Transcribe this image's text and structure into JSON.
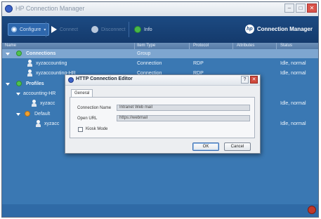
{
  "window": {
    "title": "HP Connection Manager"
  },
  "toolbar": {
    "configure": "Configure",
    "connect": "Connect",
    "disconnect": "Disconnect",
    "info": "Info",
    "brand": "Connection Manager",
    "brand_logo": "hp"
  },
  "columns": [
    "Name",
    "Item Type",
    "Protocol",
    "Attributes",
    "Status"
  ],
  "tree": {
    "connections": {
      "label": "Connections",
      "type": "Group",
      "items": [
        {
          "name": "xyzaccounting",
          "type": "Connection",
          "protocol": "RDP",
          "status": "Idle, normal"
        },
        {
          "name": "xyzaccounting-HR",
          "type": "Connection",
          "protocol": "RDP",
          "status": "Idle, normal"
        }
      ]
    },
    "profiles": {
      "label": "Profiles",
      "accounting": {
        "label": "accounting-HR",
        "item": {
          "name": "xyzacc",
          "status": "Idle, normal"
        }
      },
      "default": {
        "label": "Default",
        "item": {
          "name": "xyzacc",
          "status": "Idle, normal"
        }
      }
    }
  },
  "dialog": {
    "title": "HTTP Connection Editor",
    "tab": "General",
    "connection_name_label": "Connection Name",
    "connection_name_value": "Intranet Web mail",
    "open_url_label": "Open URL",
    "open_url_value": "https://webmail",
    "kiosk_label": "Kiosk Mode",
    "kiosk_checked": false,
    "ok": "OK",
    "cancel": "Cancel"
  },
  "colors": {
    "toolbar": "#143a6c",
    "body": "#3a78b3",
    "selected_row": "#7ea6d0",
    "status_icon": "#c0392b"
  }
}
